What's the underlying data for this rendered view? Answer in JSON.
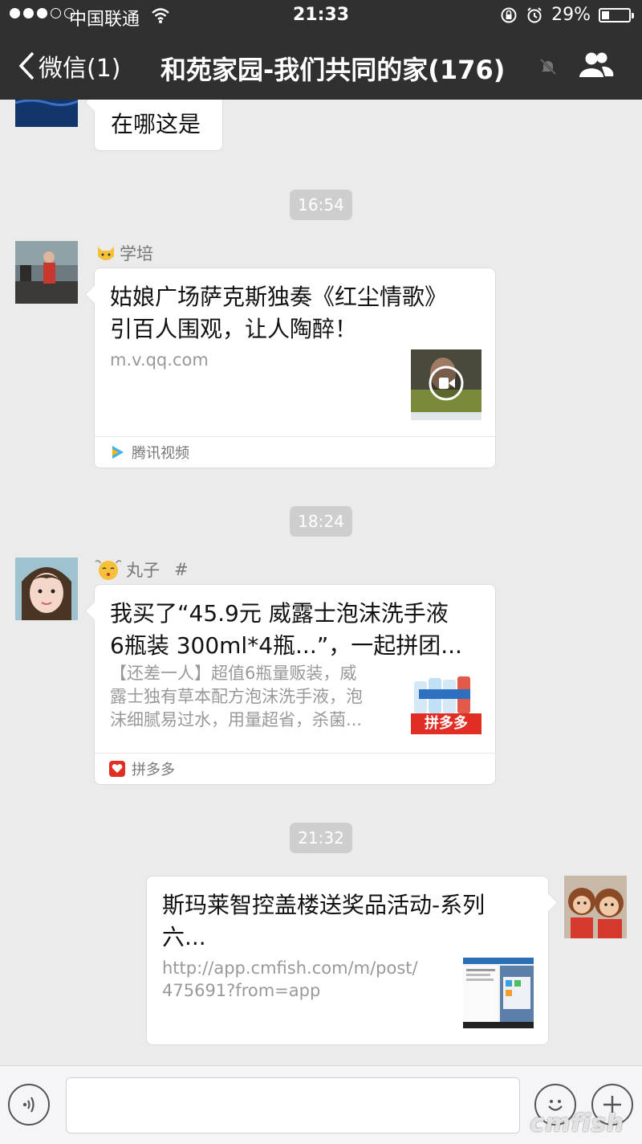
{
  "status_bar": {
    "carrier": "中国联通",
    "time": "21:33",
    "battery": "29%",
    "battery_level": 0.29
  },
  "nav": {
    "back_label": "微信(1)",
    "title": "和苑家园-我们共同的家(176)"
  },
  "messages": {
    "m1": {
      "text": "在哪这是"
    },
    "t1": "16:54",
    "m2": {
      "sender": "学培",
      "title_lines": [
        "姑娘广场萨克斯独奏《红尘情歌》",
        "引百人围观，让人陶醉！"
      ],
      "url": "m.v.qq.com",
      "source": "腾讯视频"
    },
    "t2": "18:24",
    "m3": {
      "sender": "丸子",
      "sender_suffix": "#",
      "title_lines": [
        "我买了“45.9元 威露士泡沫洗手液",
        "6瓶装 300ml*4瓶...”，一起拼团..."
      ],
      "desc_lines": [
        "【还差一人】超值6瓶量贩装，威",
        "露士独有草本配方泡沫洗手液，泡",
        "沫细腻易过水，用量超省，杀菌..."
      ],
      "thumb_label": "拼多多",
      "source": "拼多多"
    },
    "t3": "21:32",
    "m4": {
      "title_lines": [
        "斯玛莱智控盖楼送奖品活动-系列",
        "六..."
      ],
      "url_lines": [
        "http://app.cmfish.com/m/post/",
        "475691?from=app"
      ]
    }
  },
  "watermark": "cmfish",
  "colors": {
    "nav_bg": "#303030",
    "chat_bg": "#ebebeb",
    "time_pill": "#cecece",
    "pdd_red": "#e02e24"
  }
}
